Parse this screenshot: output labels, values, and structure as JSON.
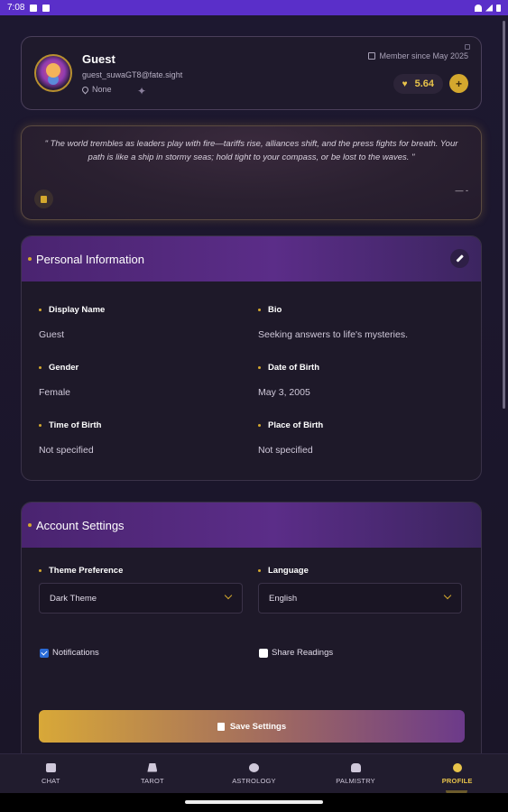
{
  "status_bar": {
    "time": "7:08"
  },
  "profile": {
    "name": "Guest",
    "email": "guest_suwaGT8@fate.sight",
    "location": "None",
    "member_since": "Member since May 2025",
    "coins": "5.64",
    "add_label": "+"
  },
  "quote": {
    "text": "\" The world trembles as leaders play with fire—tariffs rise, alliances shift, and the press fights for breath. Your path is like a ship in stormy seas; hold tight to your compass, or be lost to the waves. \"",
    "attribution": "— -"
  },
  "personal": {
    "title": "Personal Information",
    "fields": [
      {
        "label": "Display Name",
        "value": "Guest"
      },
      {
        "label": "Bio",
        "value": "Seeking answers to life's mysteries."
      },
      {
        "label": "Gender",
        "value": "Female"
      },
      {
        "label": "Date of Birth",
        "value": "May 3, 2005"
      },
      {
        "label": "Time of Birth",
        "value": "Not specified"
      },
      {
        "label": "Place of Birth",
        "value": "Not specified"
      }
    ]
  },
  "account": {
    "title": "Account Settings",
    "theme_label": "Theme Preference",
    "theme_value": "Dark Theme",
    "language_label": "Language",
    "language_value": "English",
    "notifications_label": "Notifications",
    "notifications_checked": true,
    "share_label": "Share Readings",
    "share_checked": false,
    "save_label": "Save Settings"
  },
  "nav": [
    {
      "label": "CHAT",
      "icon": "chat-icon"
    },
    {
      "label": "TAROT",
      "icon": "tarot-icon"
    },
    {
      "label": "ASTROLOGY",
      "icon": "astrology-icon"
    },
    {
      "label": "PALMISTRY",
      "icon": "palm-icon"
    },
    {
      "label": "PROFILE",
      "icon": "profile-icon",
      "active": true
    }
  ],
  "colors": {
    "accent": "#d4a82e",
    "status_bar": "#5a2fc9",
    "section_header": "#5b2d88",
    "background": "#1a1528"
  }
}
